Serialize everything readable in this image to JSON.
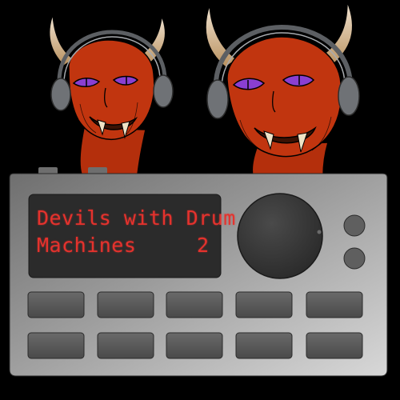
{
  "album": {
    "title_line1": "Devils with Drum",
    "title_line2": "Machines",
    "volume": "2"
  },
  "colors": {
    "background": "#000000",
    "devil_skin": "#c1350f",
    "horn": "#d6b089",
    "eye": "#8a3fd1",
    "headphone": "#7c7f83",
    "machine_body": "#8e8e8e",
    "lcd_background": "#2b2b2b",
    "lcd_text": "#e5322d",
    "pad": "#5a5a5a"
  },
  "machine": {
    "pad_rows": 2,
    "pads_per_row": 5,
    "knob": "main-dial",
    "small_buttons": 2
  }
}
